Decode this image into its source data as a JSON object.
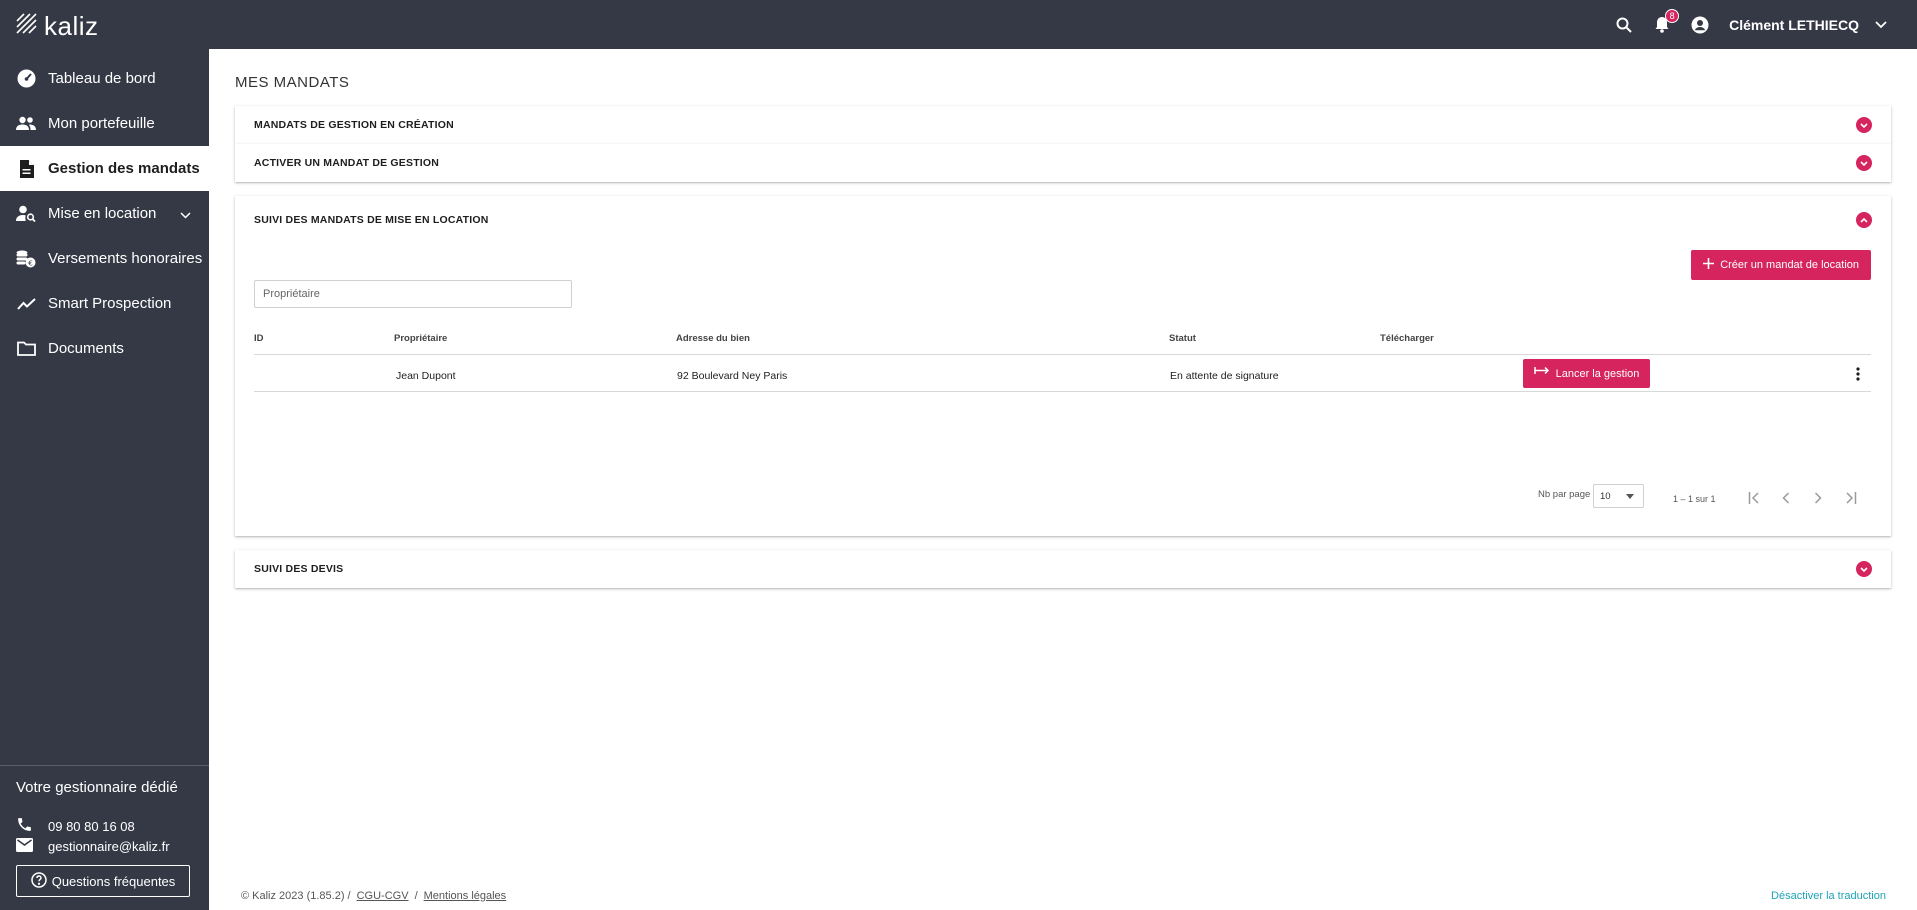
{
  "header": {
    "logo_text": "kaliz",
    "notification_count": "8",
    "user_name": "Clément LETHIECQ"
  },
  "sidebar": {
    "items": [
      {
        "label": "Tableau de bord",
        "icon": "dashboard-icon"
      },
      {
        "label": "Mon portefeuille",
        "icon": "people-icon"
      },
      {
        "label": "Gestion des mandats",
        "icon": "document-icon",
        "active": true
      },
      {
        "label": "Mise en location",
        "icon": "person-search-icon"
      },
      {
        "label": "Versements honoraires",
        "icon": "coins-icon"
      },
      {
        "label": "Smart Prospection",
        "icon": "trending-icon"
      },
      {
        "label": "Documents",
        "icon": "folder-icon"
      }
    ],
    "manager_title": "Votre gestionnaire dédié",
    "phone": "09 80 80 16 08",
    "email": "gestionnaire@kaliz.fr",
    "faq_label": "Questions fréquentes"
  },
  "main": {
    "page_title": "MES MANDATS",
    "panels": [
      {
        "title": "MANDATS DE GESTION EN CRÉATION"
      },
      {
        "title": "ACTIVER UN MANDAT DE GESTION"
      },
      {
        "title": "SUIVI DES MANDATS DE MISE EN LOCATION"
      },
      {
        "title": "SUIVI DES DEVIS"
      }
    ],
    "create_button": "Créer un mandat de location",
    "search_placeholder": "Propriétaire",
    "table": {
      "headers": [
        "ID",
        "Propriétaire",
        "Adresse du bien",
        "Statut",
        "Télécharger"
      ],
      "rows": [
        {
          "id": "",
          "owner": "Jean Dupont",
          "address": "92 Boulevard Ney Paris",
          "status": "En attente de signature",
          "action": "Lancer la gestion"
        }
      ]
    },
    "pagination": {
      "per_page_label": "Nb par page",
      "per_page_value": "10",
      "range": "1 – 1 sur 1"
    }
  },
  "footer": {
    "copyright": "© Kaliz 2023 (1.85.2) /",
    "cgu": "CGU-CGV",
    "separator": "/",
    "legal": "Mentions légales",
    "translate": "Désactiver la traduction"
  },
  "colors": {
    "sidebar_bg": "#353946",
    "accent": "#d6245e",
    "link_teal": "#1ea3b6"
  }
}
